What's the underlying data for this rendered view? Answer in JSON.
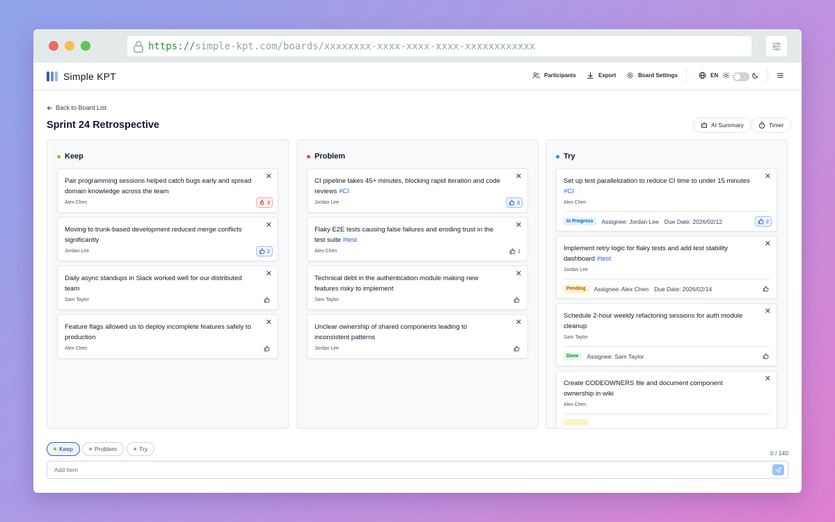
{
  "browser": {
    "url_scheme": "https://",
    "url_rest": "simple-kpt.com/boards/xxxxxxxx-xxxx-xxxx-xxxx-xxxxxxxxxxxx"
  },
  "header": {
    "app_name": "Simple KPT",
    "participants": "Participants",
    "export": "Export",
    "board_settings": "Board Settings",
    "language": "EN"
  },
  "page": {
    "back": "Back to Board List",
    "title": "Sprint 24 Retrospective",
    "ai_summary": "AI Summary",
    "timer": "Timer"
  },
  "colors": {
    "keep": "#84cc16",
    "problem": "#ef4444",
    "try": "#3b82f6",
    "logo": [
      "#3b5ba8",
      "#6b8fd6",
      "#9fb8ea"
    ]
  },
  "columns": {
    "keep": {
      "title": "Keep",
      "cards": [
        {
          "text": "Pair programming sessions helped catch bugs early and spread domain knowledge across the team",
          "author": "Alex Chen",
          "likes": "3"
        },
        {
          "text": "Moving to trunk-based development reduced merge conflicts significantly",
          "author": "Jordan Lee",
          "likes": "2"
        },
        {
          "text": "Daily async standups in Slack worked well for our distributed team",
          "author": "Sam Taylor"
        },
        {
          "text": "Feature flags allowed us to deploy incomplete features safely to production",
          "author": "Alex Chen"
        }
      ]
    },
    "problem": {
      "title": "Problem",
      "cards": [
        {
          "text": "CI pipeline takes 45+ minutes, blocking rapid iteration and code reviews",
          "tag": "#CI",
          "author": "Jordan Lee",
          "likes": "3"
        },
        {
          "text": "Flaky E2E tests causing false failures and eroding trust in the test suite",
          "tag": "#test",
          "author": "Alex Chen",
          "likes": "1"
        },
        {
          "text": "Technical debt in the authentication module making new features risky to implement",
          "author": "Sam Taylor"
        },
        {
          "text": "Unclear ownership of shared components leading to inconsistent patterns",
          "author": "Jordan Lee"
        }
      ]
    },
    "try": {
      "title": "Try",
      "cards": [
        {
          "text": "Set up test parallelization to reduce CI time to under 15 minutes",
          "tag": "#CI",
          "author": "Alex Chen",
          "status": "In Progress",
          "assignee": "Assignee: Jordan Lee",
          "due": "Due Date: 2026/02/12",
          "likes": "2"
        },
        {
          "text": "Implement retry logic for flaky tests and add test stability dashboard",
          "tag": "#test",
          "author": "Jordan Lee",
          "status": "Pending",
          "assignee": "Assignee: Alex Chen",
          "due": "Due Date: 2026/02/14"
        },
        {
          "text": "Schedule 2-hour weekly refactoring sessions for auth module cleanup",
          "author": "Sam Taylor",
          "status": "Done",
          "assignee": "Assignee: Sam Taylor"
        },
        {
          "text": "Create CODEOWNERS file and document component ownership in wiki",
          "author": "Alex Chen"
        }
      ]
    }
  },
  "composer": {
    "chips": [
      "Keep",
      "Problem",
      "Try"
    ],
    "counter": "0 / 140",
    "placeholder": "Add Item"
  }
}
